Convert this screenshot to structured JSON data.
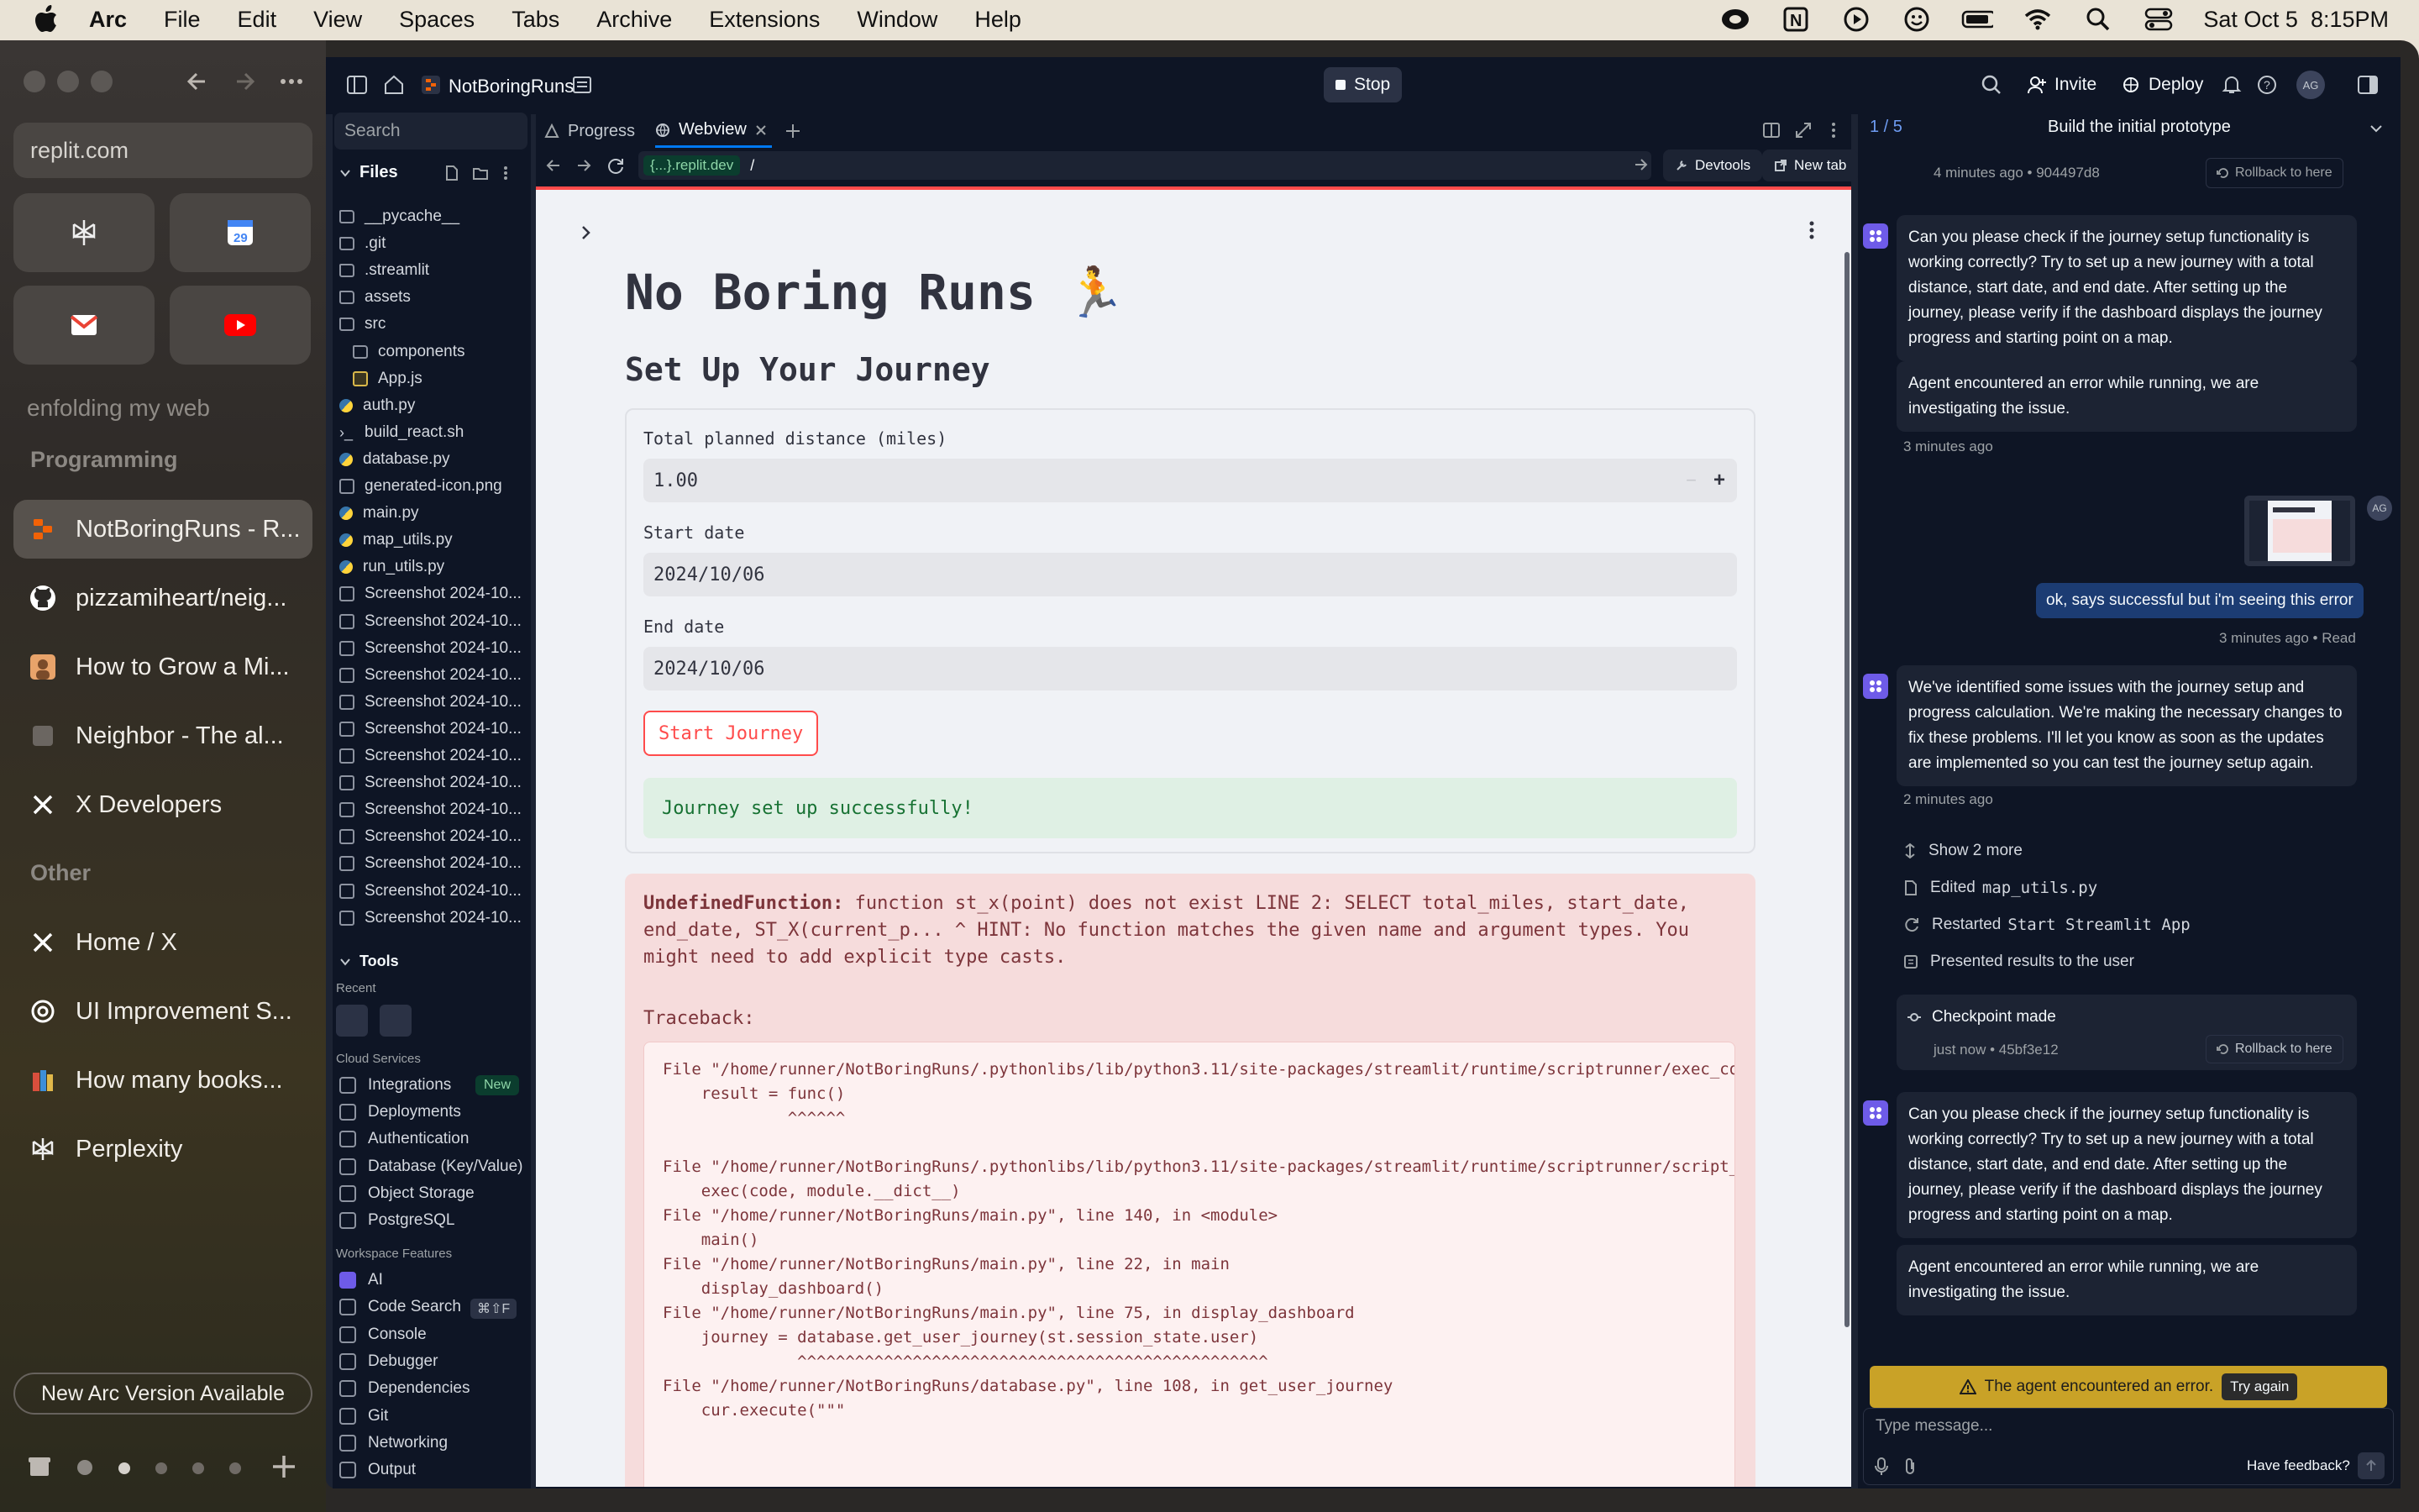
{
  "menubar": {
    "app": "Arc",
    "items": [
      "File",
      "Edit",
      "View",
      "Spaces",
      "Tabs",
      "Archive",
      "Extensions",
      "Window",
      "Help"
    ],
    "datetime": "Sat Oct 5  8:15PM"
  },
  "arc_sidebar": {
    "url": "replit.com",
    "space_title": "enfolding my web",
    "section_programming": "Programming",
    "section_other": "Other",
    "tabs_programming": [
      {
        "label": "NotBoringRuns - R...",
        "icon": "replit-icon",
        "active": true
      },
      {
        "label": "pizzamiheart/neig...",
        "icon": "github-icon"
      },
      {
        "label": "How to Grow a Mi...",
        "icon": "avatar-icon"
      },
      {
        "label": "Neighbor - The al...",
        "icon": "neighbor-icon"
      },
      {
        "label": "X Developers",
        "icon": "x-icon"
      }
    ],
    "tabs_other": [
      {
        "label": "Home / X",
        "icon": "x-icon"
      },
      {
        "label": "UI Improvement S...",
        "icon": "openai-icon"
      },
      {
        "label": "How many books...",
        "icon": "book-icon"
      },
      {
        "label": "Perplexity",
        "icon": "perplexity-icon"
      }
    ],
    "new_version": "New Arc Version Available"
  },
  "replit_top": {
    "project": "NotBoringRuns",
    "stop": "Stop",
    "invite": "Invite",
    "deploy": "Deploy",
    "avatar": "AG"
  },
  "files": {
    "search_placeholder": "Search",
    "header": "Files",
    "items": [
      {
        "name": "__pycache__",
        "type": "folder"
      },
      {
        "name": ".git",
        "type": "folder"
      },
      {
        "name": ".streamlit",
        "type": "folder"
      },
      {
        "name": "assets",
        "type": "folder"
      },
      {
        "name": "src",
        "type": "folder"
      },
      {
        "name": "components",
        "type": "folder"
      },
      {
        "name": "App.js",
        "type": "js"
      },
      {
        "name": "auth.py",
        "type": "py"
      },
      {
        "name": "build_react.sh",
        "type": "sh"
      },
      {
        "name": "database.py",
        "type": "py"
      },
      {
        "name": "generated-icon.png",
        "type": "img"
      },
      {
        "name": "main.py",
        "type": "py"
      },
      {
        "name": "map_utils.py",
        "type": "py"
      },
      {
        "name": "run_utils.py",
        "type": "py"
      },
      {
        "name": "Screenshot 2024-10...",
        "type": "img"
      },
      {
        "name": "Screenshot 2024-10...",
        "type": "img"
      },
      {
        "name": "Screenshot 2024-10...",
        "type": "img"
      },
      {
        "name": "Screenshot 2024-10...",
        "type": "img"
      },
      {
        "name": "Screenshot 2024-10...",
        "type": "img"
      },
      {
        "name": "Screenshot 2024-10...",
        "type": "img"
      },
      {
        "name": "Screenshot 2024-10...",
        "type": "img"
      },
      {
        "name": "Screenshot 2024-10...",
        "type": "img"
      },
      {
        "name": "Screenshot 2024-10...",
        "type": "img"
      },
      {
        "name": "Screenshot 2024-10...",
        "type": "img"
      },
      {
        "name": "Screenshot 2024-10...",
        "type": "img"
      },
      {
        "name": "Screenshot 2024-10...",
        "type": "img"
      },
      {
        "name": "Screenshot 2024-10...",
        "type": "img"
      }
    ]
  },
  "tools": {
    "header": "Tools",
    "recent": "Recent",
    "cloud_services": "Cloud Services",
    "cloud": [
      "Integrations",
      "Deployments",
      "Authentication",
      "Database (Key/Value)",
      "Object Storage",
      "PostgreSQL"
    ],
    "new_badge": "New",
    "workspace_features": "Workspace Features",
    "workspace": [
      "AI",
      "Code Search",
      "Console",
      "Debugger",
      "Dependencies",
      "Git",
      "Networking",
      "Output"
    ],
    "code_search_shortcut": "⌘⇧F"
  },
  "center": {
    "tabs": [
      "Progress",
      "Webview"
    ],
    "url_host": "{...}.replit.dev",
    "url_path": "/",
    "devtools": "Devtools",
    "new_tab": "New tab"
  },
  "app": {
    "title": "No Boring Runs 🏃",
    "subtitle": "Set Up Your Journey",
    "distance_label": "Total planned distance (miles)",
    "distance_value": "1.00",
    "start_label": "Start date",
    "start_value": "2024/10/06",
    "end_label": "End date",
    "end_value": "2024/10/06",
    "start_button": "Start Journey",
    "success": "Journey set up successfully!",
    "error_title": "UndefinedFunction:",
    "error_body": "function st_x(point) does not exist LINE 2: SELECT total_miles, start_date, end_date, ST_X(current_p... ^ HINT: No function matches the given name and argument types. You might need to add explicit type casts.",
    "traceback_label": "Traceback:",
    "traceback": [
      "File \"/home/runner/NotBoringRuns/.pythonlibs/lib/python3.11/site-packages/streamlit/runtime/scriptrunner/exec_code.py\"",
      "    result = func()",
      "             ^^^^^^",
      "",
      "File \"/home/runner/NotBoringRuns/.pythonlibs/lib/python3.11/site-packages/streamlit/runtime/scriptrunner/script_runner.py\"",
      "    exec(code, module.__dict__)",
      "File \"/home/runner/NotBoringRuns/main.py\", line 140, in <module>",
      "    main()",
      "File \"/home/runner/NotBoringRuns/main.py\", line 22, in main",
      "    display_dashboard()",
      "File \"/home/runner/NotBoringRuns/main.py\", line 75, in display_dashboard",
      "    journey = database.get_user_journey(st.session_state.user)",
      "              ^^^^^^^^^^^^^^^^^^^^^^^^^^^^^^^^^^^^^^^^^^^^^^^^^",
      "File \"/home/runner/NotBoringRuns/database.py\", line 108, in get_user_journey",
      "    cur.execute(\"\"\""
    ]
  },
  "chat": {
    "progress": "1 / 5",
    "task": "Build the initial prototype",
    "top_meta": "4 minutes ago • 904497d8",
    "rollback": "Rollback to here",
    "msg1": "Can you please check if the journey setup functionality is working correctly? Try to set up a new journey with a total distance, start date, and end date. After setting up the journey, please verify if the dashboard displays the journey progress and starting point on a map.",
    "err1": "Agent encountered an error while running, we are investigating the issue.",
    "meta1": "3 minutes ago",
    "user_msg": "ok, says successful but i'm seeing this error",
    "user_meta": "3 minutes ago • Read",
    "user_avatar": "AG",
    "msg2": "We've identified some issues with the journey setup and progress calculation. We're making the necessary changes to fix these problems. I'll let you know as soon as the updates are implemented so you can test the journey setup again.",
    "meta2": "2 minutes ago",
    "show_more": "Show 2 more",
    "act_edited": "Edited",
    "act_edited_file": "map_utils.py",
    "act_restarted": "Restarted",
    "act_restarted_name": "Start Streamlit App",
    "act_presented": "Presented results to the user",
    "checkpoint": "Checkpoint made",
    "checkpoint_meta": "just now • 45bf3e12",
    "msg3": "Can you please check if the journey setup functionality is working correctly? Try to set up a new journey with a total distance, start date, and end date. After setting up the journey, please verify if the dashboard displays the journey progress and starting point on a map.",
    "err3": "Agent encountered an error while running, we are investigating the issue.",
    "banner": "The agent encountered an error.",
    "try_again": "Try again",
    "input_placeholder": "Type message...",
    "feedback": "Have feedback?"
  }
}
